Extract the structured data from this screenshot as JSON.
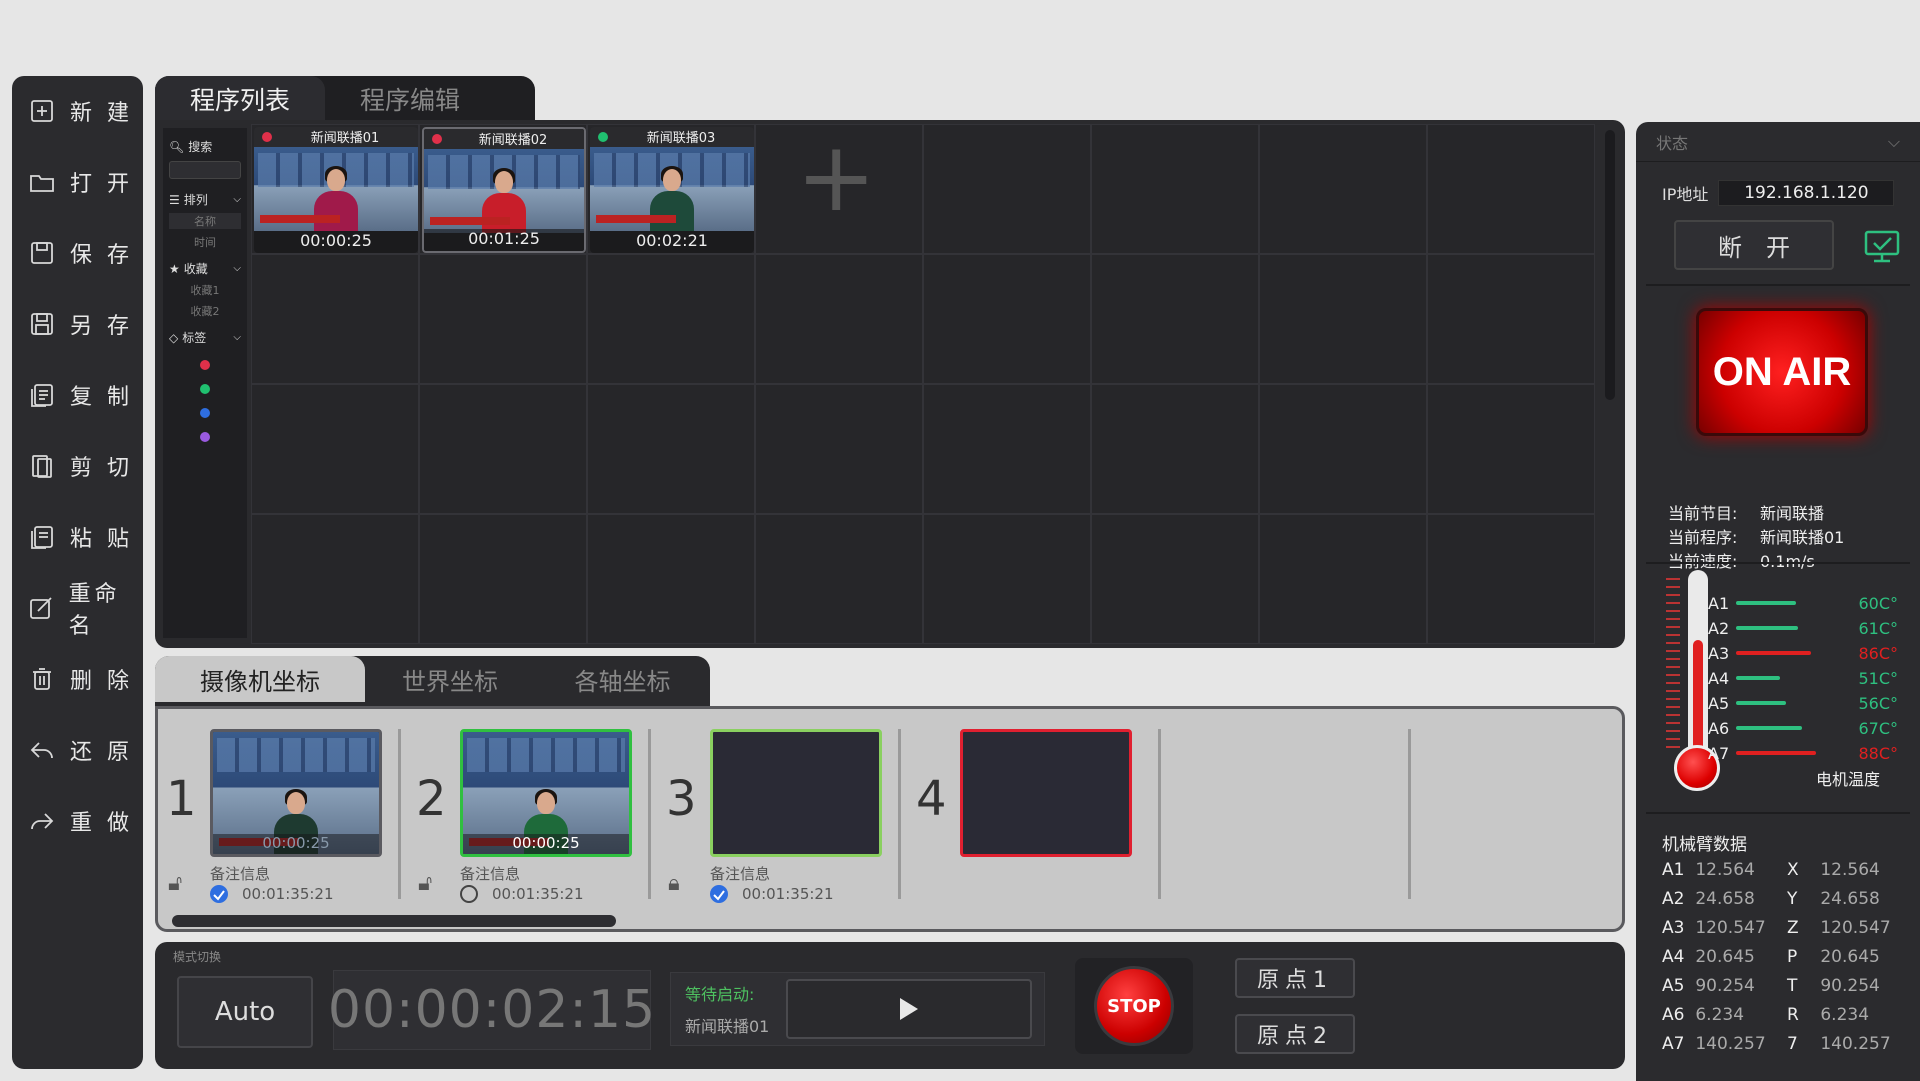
{
  "sidebar": {
    "items": [
      {
        "label": "新 建",
        "icon": "new-icon"
      },
      {
        "label": "打 开",
        "icon": "open-folder-icon"
      },
      {
        "label": "保 存",
        "icon": "save-icon"
      },
      {
        "label": "另 存",
        "icon": "save-as-icon"
      },
      {
        "label": "复 制",
        "icon": "copy-icon"
      },
      {
        "label": "剪 切",
        "icon": "cut-icon"
      },
      {
        "label": "粘 贴",
        "icon": "paste-icon"
      },
      {
        "label": "重命名",
        "icon": "rename-icon"
      },
      {
        "label": "删 除",
        "icon": "delete-icon"
      },
      {
        "label": "还 原",
        "icon": "undo-icon"
      },
      {
        "label": "重 做",
        "icon": "redo-icon"
      }
    ]
  },
  "program_tabs": [
    "程序列表",
    "程序编辑"
  ],
  "filter": {
    "search_label": "搜索",
    "sort_label": "排列",
    "sort_options": [
      "名称",
      "时间"
    ],
    "fav_label": "收藏",
    "fav_options": [
      "收藏1",
      "收藏2"
    ],
    "tag_label": "标签",
    "tag_colors": [
      "#e0304a",
      "#20c070",
      "#2e6ee0",
      "#9a5ae0"
    ]
  },
  "programs": [
    {
      "title": "新闻联播01",
      "time": "00:00:25",
      "dot": "#e0304a",
      "outfit": "#a01a4a"
    },
    {
      "title": "新闻联播02",
      "time": "00:01:25",
      "dot": "#e0304a",
      "outfit": "#c81e2a"
    },
    {
      "title": "新闻联播03",
      "time": "00:02:21",
      "dot": "#20c070",
      "outfit": "#1e4a3a"
    }
  ],
  "coord_tabs": [
    "摄像机坐标",
    "世界坐标",
    "各轴坐标"
  ],
  "slots": [
    {
      "num": "1",
      "note": "备注信息",
      "time": "00:01:35:21",
      "img_time": "00:00:25",
      "border": "#5a5a60",
      "checked": true
    },
    {
      "num": "2",
      "note": "备注信息",
      "time": "00:01:35:21",
      "img_time": "00:00:25",
      "border": "#30c040",
      "checked": false
    },
    {
      "num": "3",
      "note": "备注信息",
      "time": "00:01:35:21",
      "border": "#8ad060",
      "checked": true
    },
    {
      "num": "4",
      "border": "#e02030"
    }
  ],
  "control": {
    "mode_label": "模式切换",
    "auto_label": "Auto",
    "timecode": "00:00:02:15",
    "waiting_label": "等待启动:",
    "waiting_program": "新闻联播01",
    "stop_label": "STOP",
    "origin1": "原点1",
    "origin2": "原点2"
  },
  "status": {
    "header": "状态",
    "ip_label": "IP地址",
    "ip_value": "192.168.1.120",
    "disconnect_label": "断开",
    "onair_label": "ON AIR",
    "current": [
      {
        "k": "当前节目:",
        "v": "新闻联播"
      },
      {
        "k": "当前程序:",
        "v": "新闻联播01"
      },
      {
        "k": "当前速度:",
        "v": "0.1m/s"
      }
    ],
    "temps": [
      {
        "name": "A1",
        "value": "60C°",
        "color": "#2ec080",
        "fill": 0.6
      },
      {
        "name": "A2",
        "value": "61C°",
        "color": "#2ec080",
        "fill": 0.62
      },
      {
        "name": "A3",
        "value": "86C°",
        "color": "#e02020",
        "fill": 0.75
      },
      {
        "name": "A4",
        "value": "51C°",
        "color": "#2ec080",
        "fill": 0.44
      },
      {
        "name": "A5",
        "value": "56C°",
        "color": "#2ec080",
        "fill": 0.5
      },
      {
        "name": "A6",
        "value": "67C°",
        "color": "#2ec080",
        "fill": 0.66
      },
      {
        "name": "A7",
        "value": "88C°",
        "color": "#e02020",
        "fill": 0.8
      }
    ],
    "motor_label": "电机温度",
    "arm_title": "机械臂数据",
    "arm": [
      {
        "k1": "A1",
        "v1": "12.564",
        "k2": "X",
        "v2": "12.564"
      },
      {
        "k1": "A2",
        "v1": "24.658",
        "k2": "Y",
        "v2": "24.658"
      },
      {
        "k1": "A3",
        "v1": "120.547",
        "k2": "Z",
        "v2": "120.547"
      },
      {
        "k1": "A4",
        "v1": "20.645",
        "k2": "P",
        "v2": "20.645"
      },
      {
        "k1": "A5",
        "v1": "90.254",
        "k2": "T",
        "v2": "90.254"
      },
      {
        "k1": "A6",
        "v1": "6.234",
        "k2": "R",
        "v2": "6.234"
      },
      {
        "k1": "A7",
        "v1": "140.257",
        "k2": "7",
        "v2": "140.257"
      }
    ]
  }
}
